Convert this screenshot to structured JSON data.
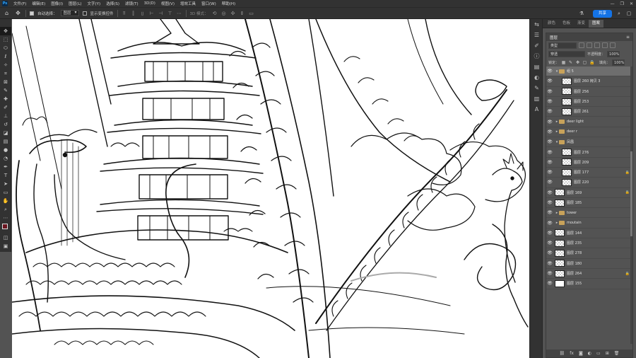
{
  "menubar": {
    "logo": "Ps",
    "items": [
      "文件(F)",
      "编辑(E)",
      "图像(I)",
      "图层(L)",
      "文字(Y)",
      "选择(S)",
      "滤镜(T)",
      "3D(D)",
      "视图(V)",
      "增效工具",
      "窗口(W)",
      "帮助(H)"
    ],
    "controls": [
      "—",
      "❐",
      "✕"
    ]
  },
  "options": {
    "auto_select_label": "自动选择：",
    "auto_select_value": "图层",
    "transform_label": "显示变换控件",
    "mode_label": "3D 模式：",
    "share_label": "共享"
  },
  "tools": [
    "move",
    "artboard",
    "marquee",
    "lasso",
    "magic-wand",
    "crop",
    "frame",
    "eyedropper",
    "healing",
    "brush",
    "stamp",
    "history-brush",
    "eraser",
    "gradient",
    "blur",
    "dodge",
    "pen",
    "type",
    "path-select",
    "rectangle",
    "hand",
    "zoom",
    "more"
  ],
  "colors": {
    "foreground": "#6b1520",
    "background": "#ffffff",
    "accent": "#1473e6"
  },
  "panels": {
    "top_tabs": [
      "颜色",
      "色板",
      "渐变",
      "图案"
    ],
    "active_tab": "图案",
    "layers_title": "图层",
    "filter_label": "类型",
    "blend_mode": "穿透",
    "opacity_label": "不透明度：",
    "opacity_value": "100%",
    "lock_label": "锁定：",
    "fill_label": "填充：",
    "fill_value": "100%"
  },
  "layers": [
    {
      "name": "组 5",
      "kind": "group",
      "depth": 0,
      "open": true,
      "selected": true
    },
    {
      "name": "图层 260 拷贝 3",
      "kind": "layer",
      "depth": 1
    },
    {
      "name": "图层 256",
      "kind": "layer",
      "depth": 1
    },
    {
      "name": "图层 253",
      "kind": "layer",
      "depth": 1
    },
    {
      "name": "图层 261",
      "kind": "layer",
      "depth": 1
    },
    {
      "name": "deer light",
      "kind": "group",
      "depth": 0
    },
    {
      "name": "deer r",
      "kind": "group",
      "depth": 0
    },
    {
      "name": "凤凰",
      "kind": "group",
      "depth": 0,
      "open": true
    },
    {
      "name": "图层 276",
      "kind": "layer",
      "depth": 1
    },
    {
      "name": "图层 209",
      "kind": "layer",
      "depth": 1
    },
    {
      "name": "图层 177",
      "kind": "layer",
      "depth": 1,
      "locked": true
    },
    {
      "name": "图层 220",
      "kind": "layer",
      "depth": 1
    },
    {
      "name": "图层 169",
      "kind": "layer",
      "depth": 0,
      "locked": true
    },
    {
      "name": "图层 185",
      "kind": "layer",
      "depth": 0
    },
    {
      "name": "tower",
      "kind": "group",
      "depth": 0
    },
    {
      "name": "moutain",
      "kind": "group",
      "depth": 0
    },
    {
      "name": "图层 144",
      "kind": "layer",
      "depth": 0
    },
    {
      "name": "图层 235",
      "kind": "layer",
      "depth": 0
    },
    {
      "name": "图层 278",
      "kind": "layer",
      "depth": 0
    },
    {
      "name": "图层 180",
      "kind": "layer",
      "depth": 0
    },
    {
      "name": "图层 264",
      "kind": "layer",
      "depth": 0,
      "locked": true
    },
    {
      "name": "图层 155",
      "kind": "layer",
      "depth": 0,
      "white": true
    }
  ],
  "footer_icons": [
    "link-icon",
    "fx-icon",
    "mask-icon",
    "adjustment-icon",
    "folder-icon",
    "new-layer-icon",
    "trash-icon"
  ]
}
